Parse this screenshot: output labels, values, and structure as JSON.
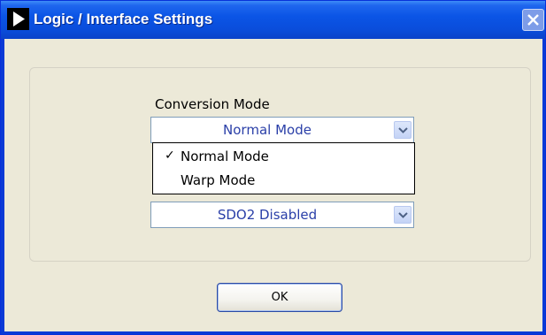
{
  "window": {
    "title": "Logic / Interface Settings"
  },
  "conversion": {
    "label": "Conversion Mode",
    "selected": "Normal Mode",
    "options": [
      "Normal Mode",
      "Warp Mode"
    ],
    "checked_index": 0,
    "checkmark": "✓"
  },
  "sdo2": {
    "selected": "SDO2 Disabled"
  },
  "buttons": {
    "ok_label": "OK"
  },
  "icons": {
    "title": "play-arrow-icon",
    "close": "close-x-icon",
    "dropdown": "chevron-down-icon"
  },
  "colors": {
    "titlebar": "#0a4ddb",
    "dialog_bg": "#ece9d8",
    "combo_text": "#2a3fa8",
    "close_button": "#7d9ce8"
  }
}
